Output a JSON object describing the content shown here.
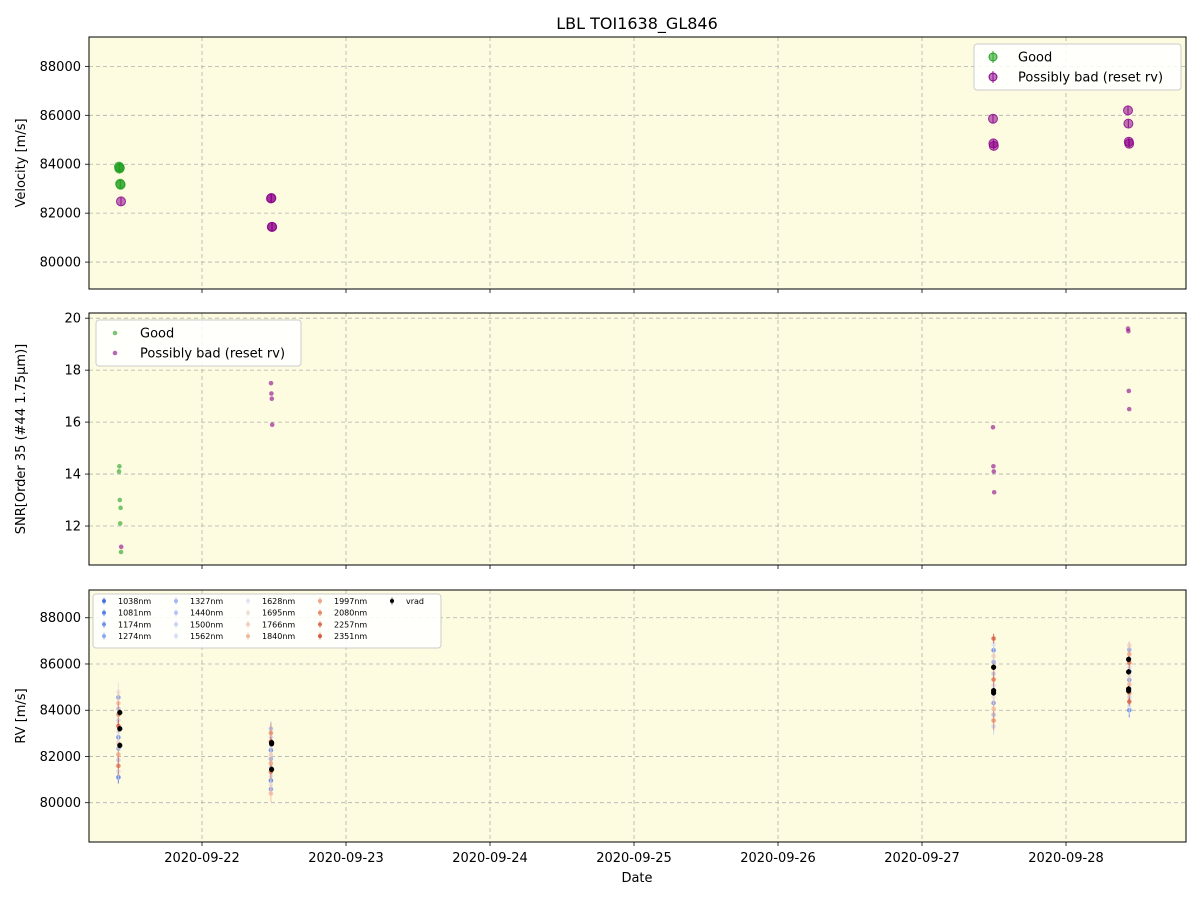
{
  "chart_data": {
    "title": "LBL TOI1638_GL846",
    "type": "scatter",
    "xlabel": "Date",
    "x_ticks": [
      "2020-09-22",
      "2020-09-23",
      "2020-09-24",
      "2020-09-25",
      "2020-09-26",
      "2020-09-27",
      "2020-09-28"
    ],
    "xlim": [
      "2020-09-21 05:10",
      "2020-09-28 20:00"
    ],
    "grid": true,
    "background_color": "#fdfce1",
    "colors": {
      "good": "#1f9e1f",
      "bad": "#8b008b",
      "vrad": "#000000"
    },
    "panels": [
      {
        "id": "velocity",
        "ylabel": "Velocity [m/s]",
        "ylim": [
          78900,
          89200
        ],
        "yticks": [
          80000,
          82000,
          84000,
          86000,
          88000
        ],
        "legend_position": "upper-right",
        "legend": [
          "Good",
          "Possibly bad (reset rv)"
        ],
        "series": [
          {
            "name": "Good",
            "points": [
              [
                "2020-09-21 10:10",
                83900
              ],
              [
                "2020-09-21 10:14",
                83820
              ],
              [
                "2020-09-21 10:18",
                83860
              ],
              [
                "2020-09-21 10:22",
                83200
              ],
              [
                "2020-09-21 10:26",
                83160
              ]
            ]
          },
          {
            "name": "Possibly bad (reset rv)",
            "points": [
              [
                "2020-09-21 10:30",
                82480
              ],
              [
                "2020-09-22 11:30",
                82600
              ],
              [
                "2020-09-22 11:34",
                82620
              ],
              [
                "2020-09-22 11:38",
                81440
              ],
              [
                "2020-09-22 11:42",
                81440
              ],
              [
                "2020-09-27 11:50",
                85860
              ],
              [
                "2020-09-27 11:54",
                84850
              ],
              [
                "2020-09-27 11:58",
                84750
              ],
              [
                "2020-09-28 10:20",
                86200
              ],
              [
                "2020-09-28 10:24",
                85660
              ],
              [
                "2020-09-28 10:28",
                84920
              ],
              [
                "2020-09-28 10:32",
                84840
              ]
            ]
          }
        ]
      },
      {
        "id": "snr",
        "ylabel": "SNR[Order 35 (#44 1.75μm)]",
        "ylim": [
          10.5,
          20.2
        ],
        "yticks": [
          12,
          14,
          16,
          18,
          20
        ],
        "legend_position": "upper-left",
        "legend": [
          "Good",
          "Possibly bad (reset rv)"
        ],
        "series": [
          {
            "name": "Good",
            "points": [
              [
                "2020-09-21 10:10",
                14.1
              ],
              [
                "2020-09-21 10:14",
                14.3
              ],
              [
                "2020-09-21 10:18",
                13.0
              ],
              [
                "2020-09-21 10:22",
                12.1
              ],
              [
                "2020-09-21 10:26",
                12.7
              ],
              [
                "2020-09-21 10:30",
                11.0
              ]
            ]
          },
          {
            "name": "Possibly bad (reset rv)",
            "points": [
              [
                "2020-09-21 10:32",
                11.2
              ],
              [
                "2020-09-22 11:30",
                17.5
              ],
              [
                "2020-09-22 11:34",
                17.1
              ],
              [
                "2020-09-22 11:38",
                16.9
              ],
              [
                "2020-09-22 11:42",
                15.9
              ],
              [
                "2020-09-27 11:50",
                15.8
              ],
              [
                "2020-09-27 11:54",
                14.3
              ],
              [
                "2020-09-27 11:58",
                14.1
              ],
              [
                "2020-09-27 12:02",
                13.3
              ],
              [
                "2020-09-28 10:20",
                19.6
              ],
              [
                "2020-09-28 10:24",
                19.5
              ],
              [
                "2020-09-28 10:28",
                17.2
              ],
              [
                "2020-09-28 10:32",
                16.5
              ]
            ]
          }
        ]
      },
      {
        "id": "rv",
        "ylabel": "RV [m/s]",
        "ylim": [
          78300,
          89200
        ],
        "yticks": [
          80000,
          82000,
          84000,
          86000,
          88000
        ],
        "legend_position": "upper-left",
        "legend_columns": 5,
        "legend": [
          "1038nm",
          "1081nm",
          "1174nm",
          "1274nm",
          "1327nm",
          "1440nm",
          "1500nm",
          "1562nm",
          "1628nm",
          "1695nm",
          "1766nm",
          "1840nm",
          "1997nm",
          "2080nm",
          "2257nm",
          "2351nm",
          "vrad"
        ],
        "band_colors": [
          "#4a6fe0",
          "#5b82e8",
          "#6f93ec",
          "#8aa9f0",
          "#9fb8f2",
          "#b4c7f4",
          "#c7d5f6",
          "#d5def7",
          "#dfe3f5",
          "#eeded8",
          "#f3cdbf",
          "#f4b89f",
          "#efa383",
          "#e98b6a",
          "#df6f52",
          "#d65a43",
          "#000000"
        ],
        "nights": [
          {
            "x": "2020-09-21 10:18",
            "vrad": [
              83900,
              83200,
              82480
            ],
            "range": [
              81100,
              84800
            ],
            "err": 450
          },
          {
            "x": "2020-09-22 11:36",
            "vrad": [
              82600,
              82550,
              81440
            ],
            "range": [
              80400,
              83200
            ],
            "err": 350
          },
          {
            "x": "2020-09-27 11:56",
            "vrad": [
              85860,
              84850,
              84750
            ],
            "range": [
              83300,
              87100
            ],
            "err": 350
          },
          {
            "x": "2020-09-28 10:26",
            "vrad": [
              86200,
              85660,
              84920,
              84840
            ],
            "range": [
              84000,
              86800
            ],
            "err": 300
          }
        ]
      }
    ]
  }
}
